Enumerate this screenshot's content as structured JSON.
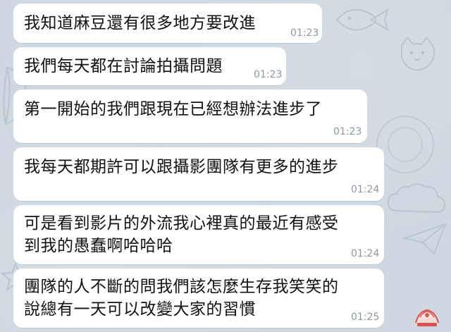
{
  "messages": [
    {
      "text": "我知道麻豆還有很多地方要改進",
      "time": "01:23"
    },
    {
      "text": "我們每天都在討論拍攝問題",
      "time": "01:23"
    },
    {
      "text": "第一開始的我們跟現在已經想辦法進步了",
      "time": "01:23"
    },
    {
      "text": "我每天都期許可以跟攝影團隊有更多的進步",
      "time": "01:24"
    },
    {
      "text_lines": [
        "可是看到影片的外流我心裡真的最近有感受",
        "到我的愚蠢啊哈哈哈"
      ],
      "time": "01:24"
    },
    {
      "text_lines": [
        "團隊的人不斷的問我們該怎麼生存我笑笑的",
        "說總有一天可以改變大家的習慣"
      ],
      "time": "01:25"
    }
  ],
  "colors": {
    "chat_background": "#cfd8e0",
    "bubble": "#ffffff",
    "text": "#111111",
    "timestamp": "#8d99a3",
    "watermark_accent": "#d9534f"
  },
  "watermark": {
    "icon": "watermark-logo"
  }
}
